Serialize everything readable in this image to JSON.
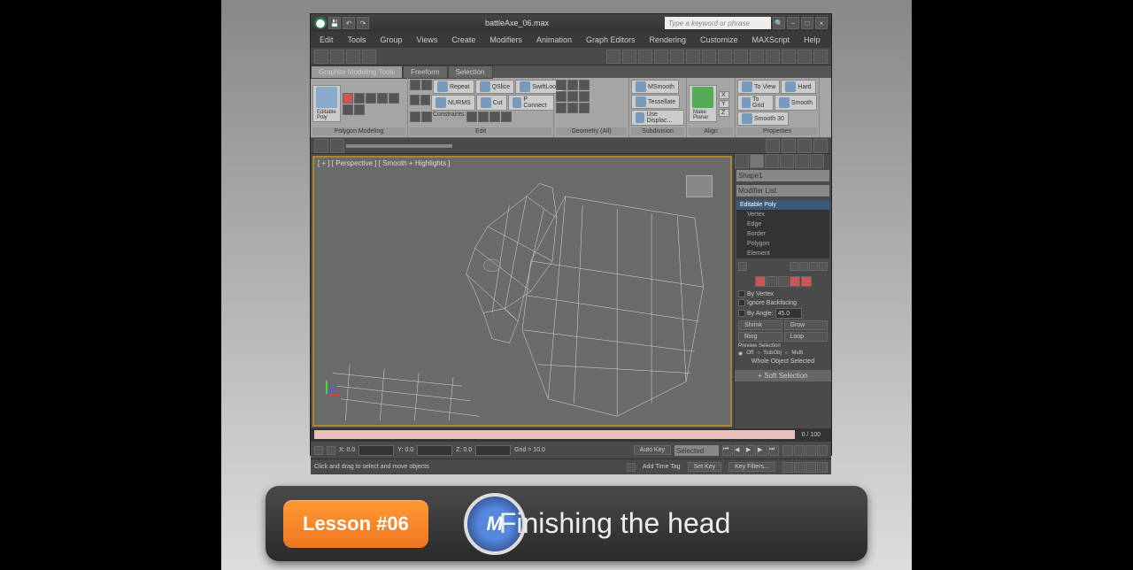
{
  "title": "battleAxe_06.max",
  "search_placeholder": "Type a keyword or phrase",
  "menu": [
    "Edit",
    "Tools",
    "Group",
    "Views",
    "Create",
    "Modifiers",
    "Animation",
    "Graph Editors",
    "Rendering",
    "Customize",
    "MAXScript",
    "Help"
  ],
  "ribbon_tabs": {
    "main": "Graphite Modeling Tools",
    "freeform": "Freeform",
    "selection": "Selection"
  },
  "ribbon_groups": {
    "polymodel": "Polygon Modeling",
    "editpoly": "Editable Poly",
    "edit": "Edit",
    "geometry": "Geometry (All)",
    "subdivision": "Subdivision",
    "align": "Align",
    "properties": "Properties"
  },
  "ribbon_items": {
    "repeat": "Repeat",
    "nurms": "NURMS",
    "constraints": "Constraints:",
    "qslice": "QSlice",
    "cut": "Cut",
    "swiftloop": "SwiftLoop",
    "pconnect": "P Connect",
    "msmooth": "MSmooth",
    "tessellate": "Tessellate",
    "usedisplace": "Use Displac...",
    "makeplanar": "Make Planar",
    "x": "X",
    "y": "Y",
    "z": "Z",
    "toview": "To View",
    "togrid": "To Grid",
    "hard": "Hard",
    "smooth": "Smooth",
    "smooth30": "Smooth 30"
  },
  "viewport": {
    "label": "[ + ] [ Perspective ] [ Smooth + Highlights ]"
  },
  "panel": {
    "object_name": "Shape1",
    "modifier_list_label": "Modifier List",
    "editable_poly": "Editable Poly",
    "vertex": "Vertex",
    "edge": "Edge",
    "border": "Border",
    "polygon": "Polygon",
    "element": "Element",
    "by_vertex": "By Vertex",
    "ignore_backfacing": "Ignore Backfacing",
    "by_angle": "By Angle:",
    "angle_val": "45.0",
    "shrink": "Shrink",
    "grow": "Grow",
    "ring": "Ring",
    "loop": "Loop",
    "preview_sel": "Preview Selection",
    "off": "Off",
    "subobj": "SubObj",
    "multi": "Multi",
    "whole_obj": "Whole Object Selected",
    "soft_selection": "Soft Selection"
  },
  "timeline": {
    "position": "0 / 100"
  },
  "bottom": {
    "x": "X: 0.0",
    "y": "Y: 0.0",
    "z": "Z: 0.0",
    "grid": "Grid = 10.0",
    "autokey": "Auto Key",
    "selected": "Selected",
    "setkey": "Set Key",
    "keyfilters": "Key Filters..."
  },
  "status": {
    "hint": "Click and drag to select and move objects",
    "addtag": "Add Time Tag"
  },
  "lesson": {
    "badge": "Lesson #06",
    "title": "Finishing the head",
    "logo_text": "M"
  }
}
